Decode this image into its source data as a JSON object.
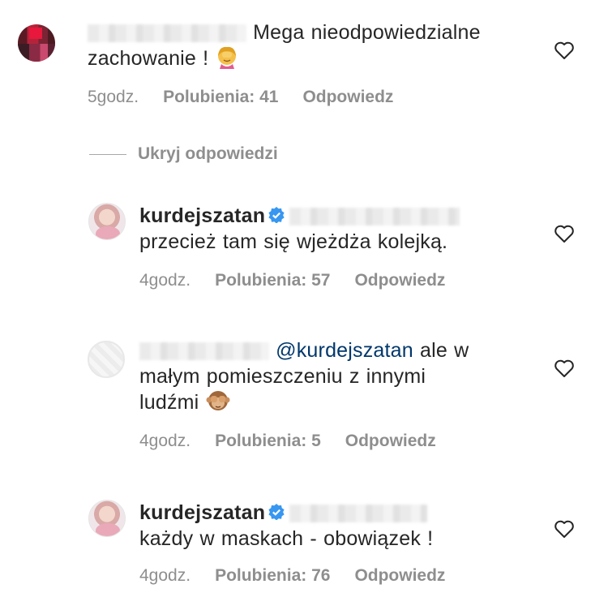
{
  "comments": [
    {
      "text_line1": "Mega nieodpowiedzialne",
      "text_line2": "zachowanie !",
      "emoji": "woman-facepalming",
      "time": "5godz.",
      "likes": "Polubienia: 41",
      "reply": "Odpowiedz"
    }
  ],
  "thread": {
    "hide_replies": "Ukryj odpowiedzi"
  },
  "replies": [
    {
      "username": "kurdejszatan",
      "verified": true,
      "text": "przecież tam się wjeżdża kolejką.",
      "time": "4godz.",
      "likes": "Polubienia: 57",
      "reply": "Odpowiedz"
    },
    {
      "mention": "@kurdejszatan",
      "text_line1": "ale w",
      "text_line2": "małym pomieszczeniu z innymi",
      "text_line3": "ludźmi",
      "emoji": "see-no-evil-monkey",
      "time": "4godz.",
      "likes": "Polubienia: 5",
      "reply": "Odpowiedz"
    },
    {
      "username": "kurdejszatan",
      "verified": true,
      "text": "każdy w maskach - obowiązek !",
      "time": "4godz.",
      "likes": "Polubienia: 76",
      "reply": "Odpowiedz"
    }
  ],
  "colors": {
    "text": "#262626",
    "muted": "#8e8e8e",
    "mention": "#00376b",
    "verified": "#3897f0"
  }
}
